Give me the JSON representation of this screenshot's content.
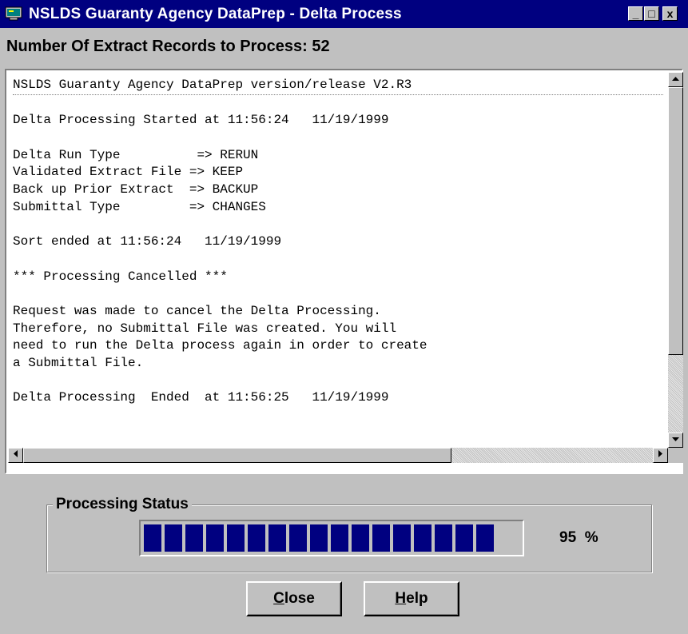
{
  "window": {
    "title": "NSLDS Guaranty Agency DataPrep - Delta Process",
    "controls": {
      "minimize": "_",
      "maximize": "□",
      "close": "x"
    }
  },
  "header": {
    "records_label": "Number Of Extract Records to Process: 52"
  },
  "log": {
    "lines": [
      "NSLDS Guaranty Agency DataPrep version/release V2.R3",
      "",
      "Delta Processing Started at 11:56:24   11/19/1999",
      "",
      "Delta Run Type          => RERUN",
      "Validated Extract File => KEEP",
      "Back up Prior Extract  => BACKUP",
      "Submittal Type         => CHANGES",
      "",
      "Sort ended at 11:56:24   11/19/1999",
      "",
      "*** Processing Cancelled ***",
      "",
      "Request was made to cancel the Delta Processing.",
      "Therefore, no Submittal File was created. You will",
      "need to run the Delta process again in order to create",
      "a Submittal File.",
      "",
      "Delta Processing  Ended  at 11:56:25   11/19/1999"
    ]
  },
  "status": {
    "legend": "Processing Status",
    "progress_fraction": 0.95,
    "percent_text": "95  %"
  },
  "buttons": {
    "close": {
      "accel": "C",
      "rest": "lose"
    },
    "help": {
      "accel": "H",
      "rest": "elp"
    }
  },
  "colors": {
    "title_bar": "#000080",
    "progress_block": "#000080",
    "face": "#c0c0c0"
  },
  "icons": {
    "app": "dataprep-app-icon",
    "scroll_up": "arrow-up-icon",
    "scroll_down": "arrow-down-icon",
    "scroll_left": "arrow-left-icon",
    "scroll_right": "arrow-right-icon"
  }
}
